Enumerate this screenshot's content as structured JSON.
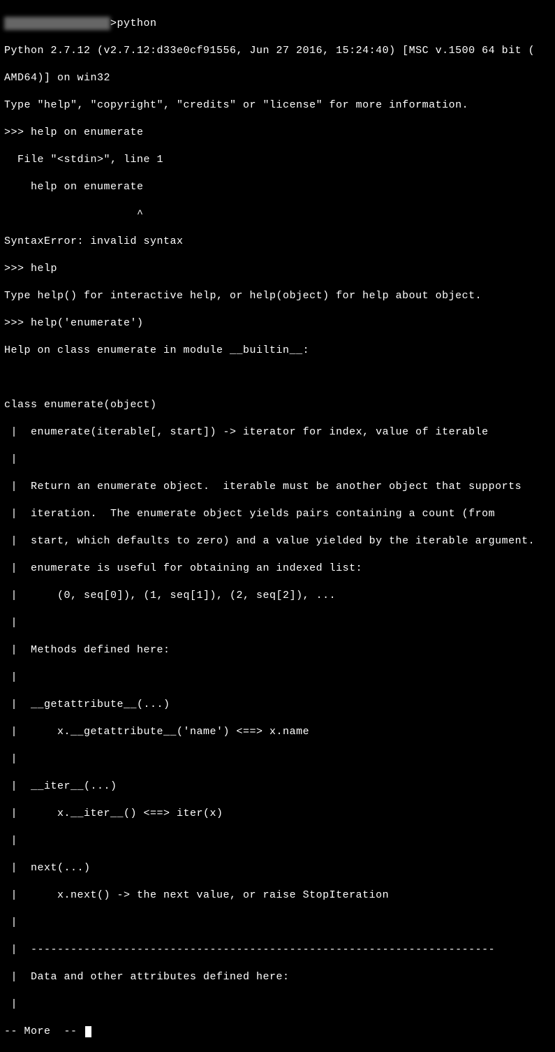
{
  "terminal": {
    "promptPathObscured": "████████████████",
    "promptCommand": ">python",
    "lines": [
      "Python 2.7.12 (v2.7.12:d33e0cf91556, Jun 27 2016, 15:24:40) [MSC v.1500 64 bit (",
      "AMD64)] on win32",
      "Type \"help\", \"copyright\", \"credits\" or \"license\" for more information.",
      ">>> help on enumerate",
      "  File \"<stdin>\", line 1",
      "    help on enumerate",
      "                    ^",
      "SyntaxError: invalid syntax",
      ">>> help",
      "Type help() for interactive help, or help(object) for help about object.",
      ">>> help('enumerate')",
      "Help on class enumerate in module __builtin__:",
      "",
      "class enumerate(object)",
      " |  enumerate(iterable[, start]) -> iterator for index, value of iterable",
      " |",
      " |  Return an enumerate object.  iterable must be another object that supports",
      " |  iteration.  The enumerate object yields pairs containing a count (from",
      " |  start, which defaults to zero) and a value yielded by the iterable argument.",
      " |  enumerate is useful for obtaining an indexed list:",
      " |      (0, seq[0]), (1, seq[1]), (2, seq[2]), ...",
      " |",
      " |  Methods defined here:",
      " |",
      " |  __getattribute__(...)",
      " |      x.__getattribute__('name') <==> x.name",
      " |",
      " |  __iter__(...)",
      " |      x.__iter__() <==> iter(x)",
      " |",
      " |  next(...)",
      " |      x.next() -> the next value, or raise StopIteration",
      " |",
      " |  ----------------------------------------------------------------------",
      " |  Data and other attributes defined here:",
      " |",
      "-- More  -- "
    ]
  }
}
